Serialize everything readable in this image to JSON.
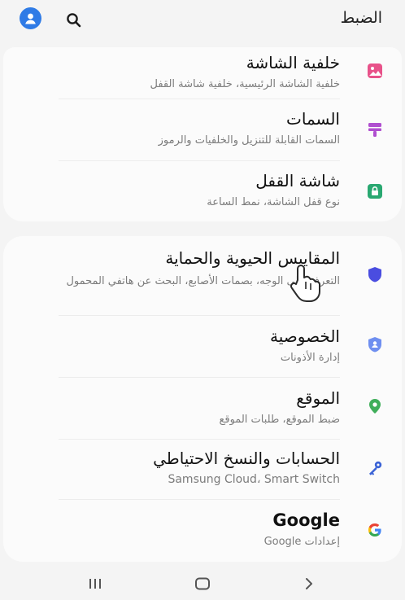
{
  "header": {
    "title": "الضبط",
    "icons": {
      "profile": "profile-avatar-icon",
      "search": "search-icon"
    },
    "accent": "#2f7be6"
  },
  "group1": [
    {
      "title": "خلفية الشاشة",
      "subtitle": "خلفية الشاشة الرئيسية، خلفية شاشة القفل",
      "icon": "wallpaper-icon",
      "color": "#e8528a"
    },
    {
      "title": "السمات",
      "subtitle": "السمات القابلة للتنزيل والخلفيات والرموز",
      "icon": "themes-brush-icon",
      "color": "#b04fd0"
    },
    {
      "title": "شاشة القفل",
      "subtitle": "نوع قفل الشاشة، نمط الساعة",
      "icon": "lock-screen-icon",
      "color": "#29a871"
    }
  ],
  "group2": [
    {
      "title": "المقاييس الحيوية والحماية",
      "subtitle": "التعرف على الوجه، بصمات الأصابع، البحث عن هاتفي المحمول",
      "icon": "biometrics-shield-icon",
      "color": "#4a4de0"
    },
    {
      "title": "الخصوصية",
      "subtitle": "إدارة الأذونات",
      "icon": "privacy-shield-icon",
      "color": "#6f8ff0"
    },
    {
      "title": "الموقع",
      "subtitle": "ضبط الموقع، طلبات الموقع",
      "icon": "location-pin-icon",
      "color": "#3fae5a"
    },
    {
      "title": "الحسابات والنسخ الاحتياطي",
      "subtitle": "Samsung Cloud، Smart Switch",
      "icon": "accounts-key-icon",
      "color": "#3b63d6"
    },
    {
      "title": "Google",
      "subtitle": "إعدادات Google",
      "icon": "google-icon",
      "color": "#4285f4"
    }
  ],
  "navbar": {
    "recents": "recents-icon",
    "home": "home-icon",
    "back": "back-icon"
  }
}
